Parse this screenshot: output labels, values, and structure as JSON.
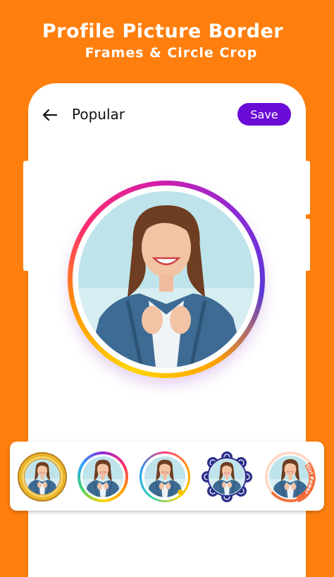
{
  "promo": {
    "title_line1": "Profile Picture Border",
    "title_line2": "Frames & Circle Crop"
  },
  "header": {
    "back_icon": "arrow-left-icon",
    "title": "Popular",
    "save_label": "Save"
  },
  "frames": [
    {
      "name": "gold-badge-frame"
    },
    {
      "name": "rainbow-ring-frame"
    },
    {
      "name": "gradient-thin-ring-frame"
    },
    {
      "name": "flower-pattern-frame"
    },
    {
      "name": "girl-power-frame",
      "text": "Girl Power"
    }
  ],
  "colors": {
    "background": "#ff7f0e",
    "save_button": "#6a0bd6",
    "screen": "#ffffff"
  }
}
